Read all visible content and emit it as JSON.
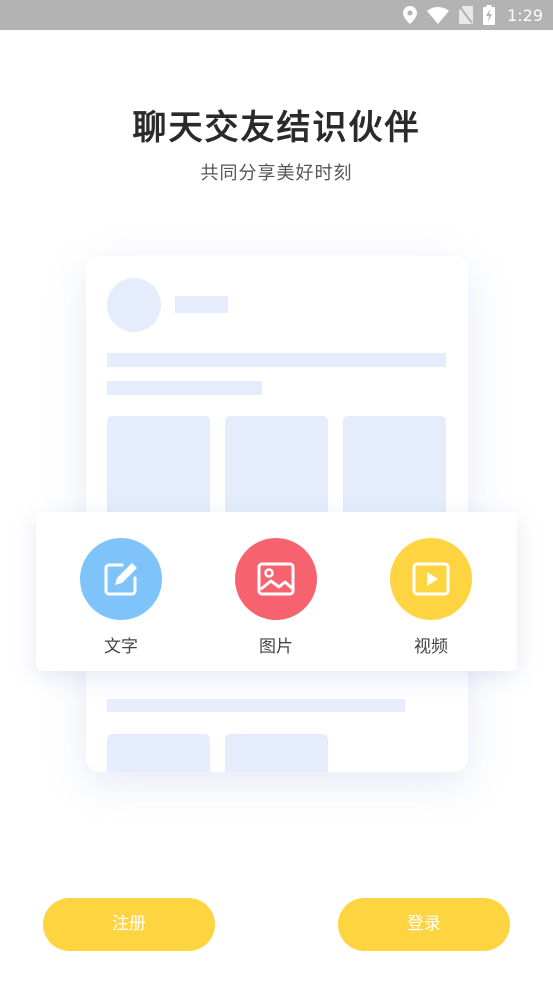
{
  "status_bar": {
    "time": "1:29",
    "icons": [
      "location-icon",
      "wifi-icon",
      "no-sim-icon",
      "battery-charging-icon"
    ]
  },
  "header": {
    "title": "聊天交友结识伙伴",
    "subtitle": "共同分享美好时刻"
  },
  "post_types": [
    {
      "label": "文字",
      "icon": "edit-icon",
      "color": "#7ec4fb"
    },
    {
      "label": "图片",
      "icon": "image-icon",
      "color": "#f6636e"
    },
    {
      "label": "视频",
      "icon": "video-icon",
      "color": "#fed440"
    }
  ],
  "actions": {
    "register_label": "注册",
    "login_label": "登录"
  },
  "colors": {
    "placeholder": "#e5edfc",
    "button": "#fed440",
    "status_bar": "#b3b3b3"
  }
}
